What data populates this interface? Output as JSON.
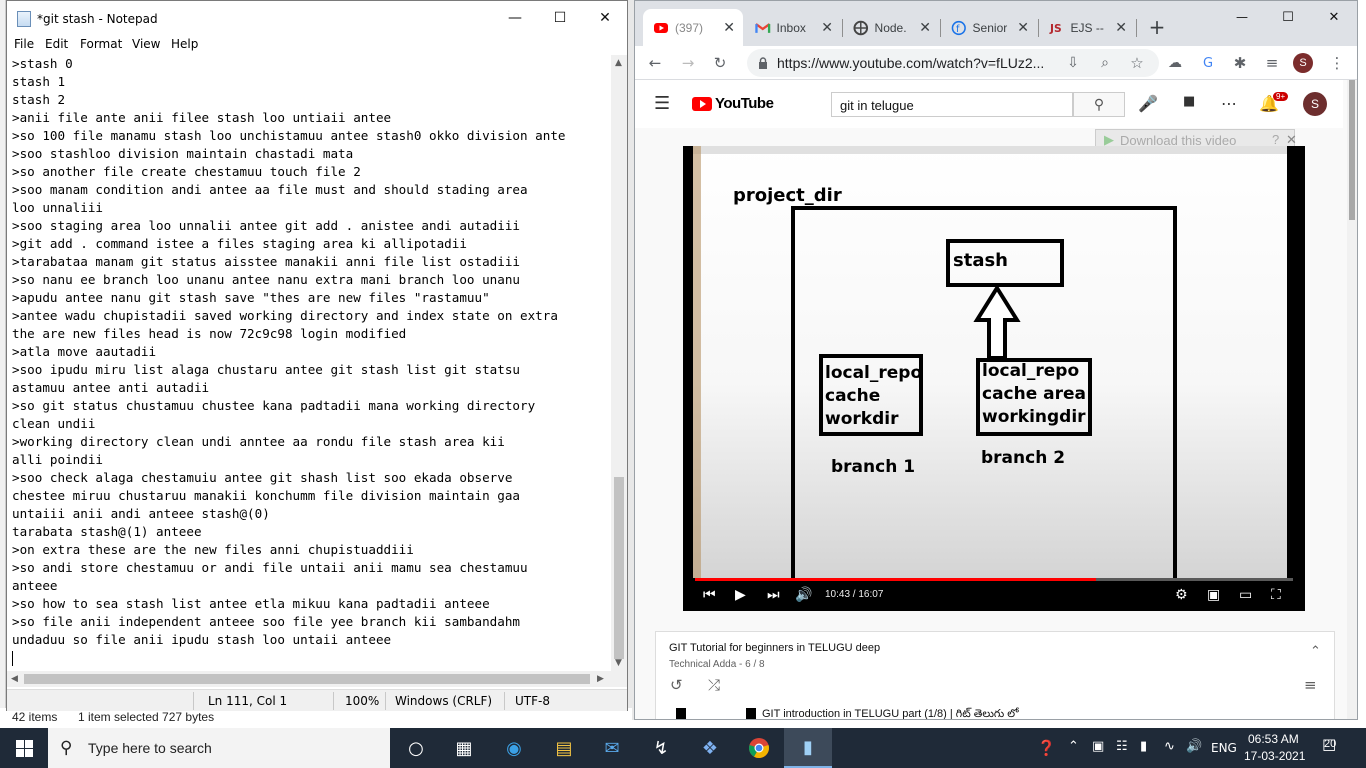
{
  "explorer": {
    "items": "42 items",
    "selected": "1 item selected  727 bytes"
  },
  "notepad": {
    "title": "*git stash - Notepad",
    "menu": [
      "File",
      "Edit",
      "Format",
      "View",
      "Help"
    ],
    "lines": [
      ">stash 0",
      "stash 1",
      "stash 2",
      ">anii file ante anii filee stash loo untiaii antee",
      ">so 100 file manamu stash loo unchistamuu antee stash0 okko division ante",
      ">soo stashloo division maintain chastadi mata",
      ">so another file create chestamuu touch file 2",
      ">soo manam condition andi antee aa file must and should stading area",
      "loo unnaliii",
      ">soo staging area loo unnalii antee git add . anistee andi autadiii",
      ">git add . command istee a files staging area ki allipotadii",
      ">tarabataa manam git status aisstee manakii anni file list ostadiii",
      ">so nanu ee branch loo unanu antee nanu extra mani branch loo unanu",
      ">apudu antee nanu git stash save \"thes are new files \"rastamuu\"",
      ">antee wadu chupistadii saved working directory and index state on extra",
      "the are new files head is now 72c9c98 login modified",
      ">atla move aautadii",
      ">soo ipudu miru list alaga chustaru antee git stash list git statsu",
      "astamuu antee anti autadii",
      ">so git status chustamuu chustee kana padtadii mana working directory",
      "clean undii",
      ">working directory clean undi anntee aa rondu file stash area kii",
      "alli poindii",
      ">soo check alaga chestamuiu antee git shash list soo ekada observe",
      "chestee miruu chustaruu manakii konchumm file division maintain gaa",
      "untaiii anii andi anteee stash@(0)",
      "tarabata stash@(1) anteee",
      ">on extra these are the new files anni chupistuaddiii",
      ">so andi store chestamuu or andi file untaii anii mamu sea chestamuu",
      "anteee",
      ">so how to sea stash list antee etla mikuu kana padtadii anteee",
      ">so file anii independent anteee soo file yee branch kii sambandahm",
      "undaduu so file anii ipudu stash loo untaii anteee"
    ],
    "status": {
      "position": "Ln 111, Col 1",
      "zoom": "100%",
      "eol": "Windows (CRLF)",
      "encoding": "UTF-8"
    }
  },
  "chrome": {
    "tabs": [
      {
        "label": "(397)",
        "icon": "youtube-icon"
      },
      {
        "label": "Inbox",
        "icon": "gmail-icon"
      },
      {
        "label": "Node.",
        "icon": "nodejs-icon"
      },
      {
        "label": "Senior",
        "icon": "page-icon"
      },
      {
        "label": "EJS --",
        "icon": "ejs-icon"
      }
    ],
    "url": "https://www.youtube.com/watch?v=fLUz2...",
    "profile_initial": "S"
  },
  "youtube": {
    "logo": "YouTube",
    "search_value": "git in telugue",
    "notification_badge": "9+",
    "avatar_initial": "S",
    "download_banner": "Download this video",
    "slide": {
      "project_dir": "project_dir",
      "stash": "stash",
      "repo1": "local_repo\ncache\nworkdir",
      "repo2": "local_repo\ncache area\nworkingdir",
      "branch1": "branch 1",
      "branch2": "branch 2"
    },
    "player": {
      "time": "10:43 / 16:07",
      "progress": 0.67
    },
    "playlist": {
      "title": "GIT Tutorial for beginners in TELUGU deep",
      "subtitle": "Technical Adda - 6 / 8",
      "item_title": "GIT introduction in TELUGU part (1/8) | గిట్ తెలుగు లో"
    }
  },
  "taskbar": {
    "search_placeholder": "Type here to search",
    "language": "ENG",
    "time": "06:53 AM",
    "date": "17-03-2021",
    "notification_count": "20"
  }
}
